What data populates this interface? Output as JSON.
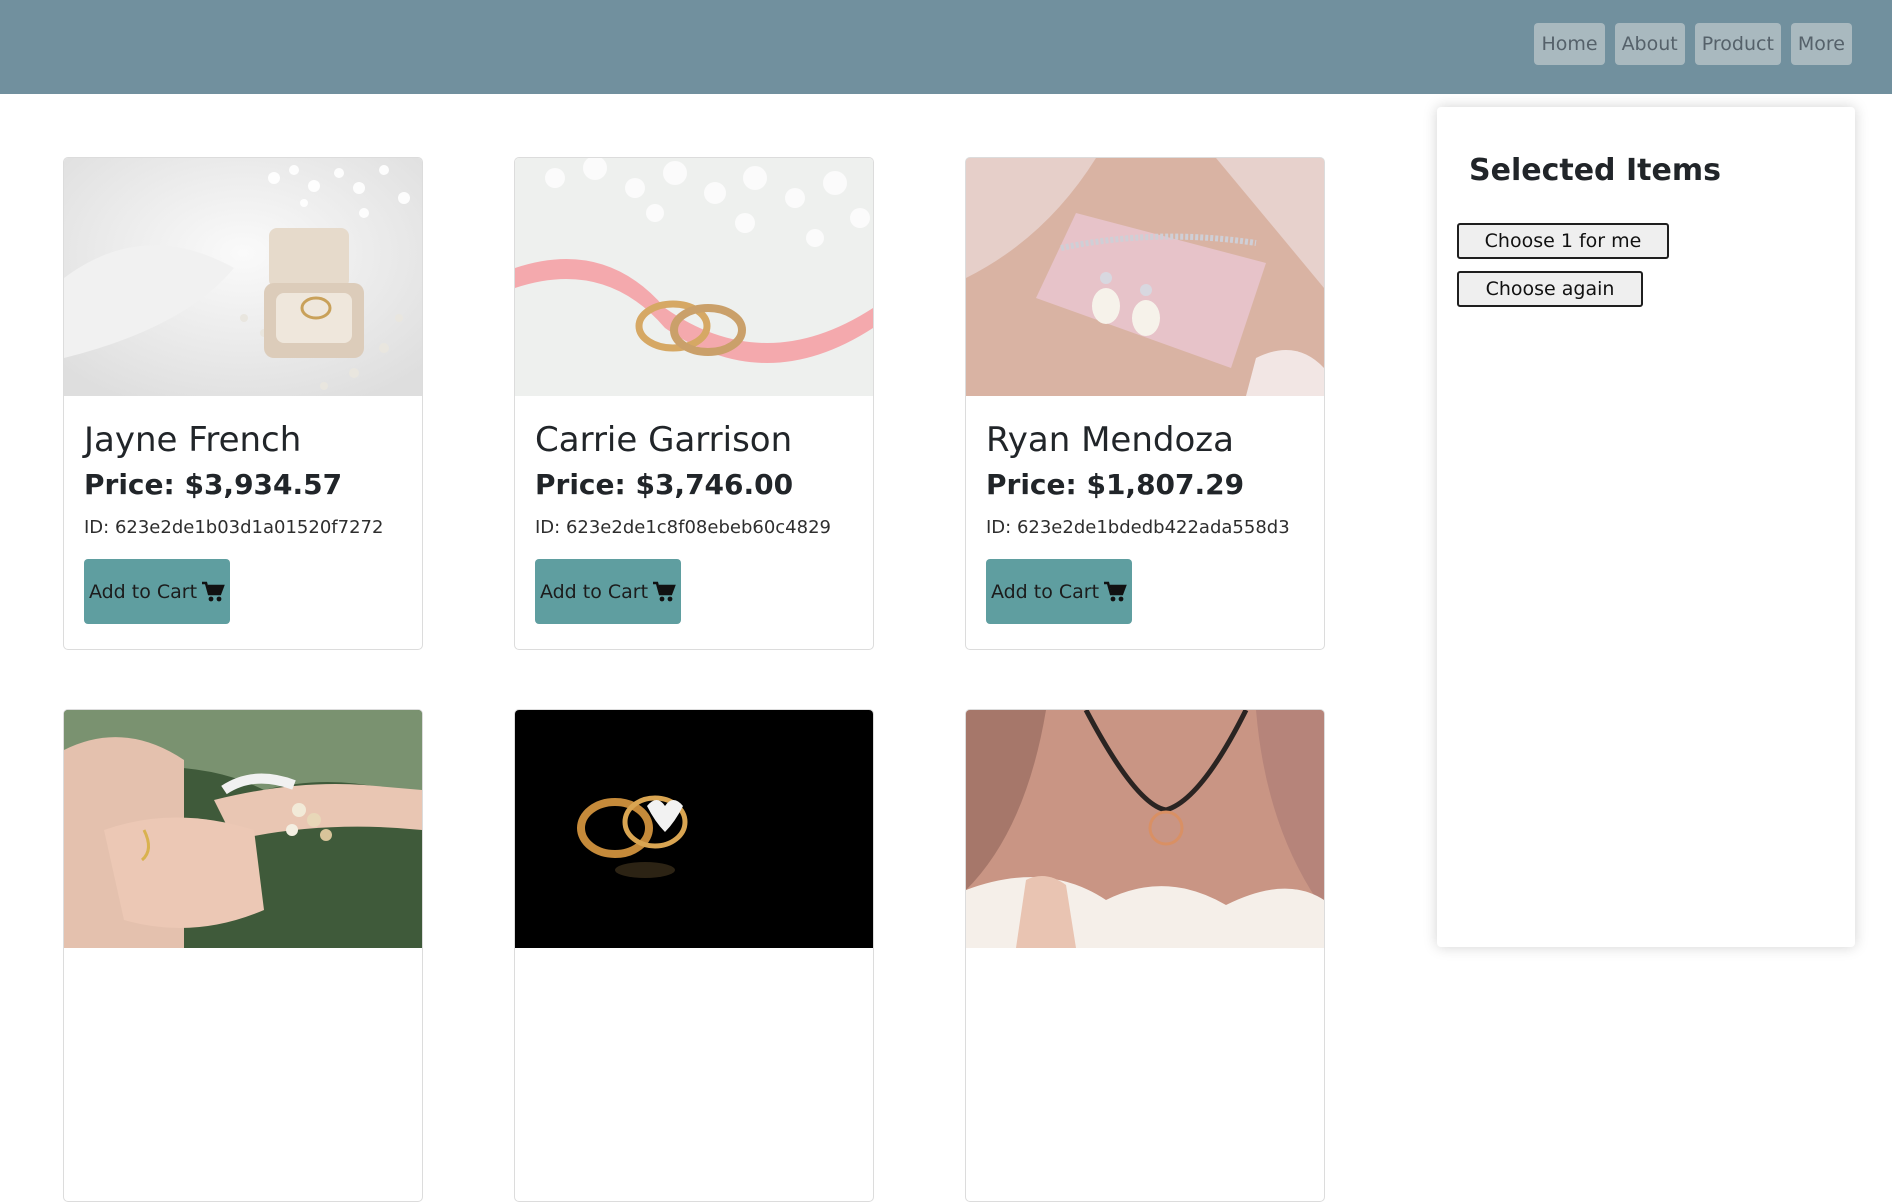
{
  "nav": {
    "items": [
      "Home",
      "About",
      "Product",
      "More"
    ]
  },
  "products": [
    {
      "name": "Jayne French",
      "price": "Price: $3,934.57",
      "id": "ID: 623e2de1b03d1a01520f7272",
      "button": "Add to Cart",
      "image": "ring-box-photo"
    },
    {
      "name": "Carrie Garrison",
      "price": "Price: $3,746.00",
      "id": "ID: 623e2de1c8f08ebeb60c4829",
      "button": "Add to Cart",
      "image": "wedding-bands-photo"
    },
    {
      "name": "Ryan Mendoza",
      "price": "Price: $1,807.29",
      "id": "ID: 623e2de1bdedb422ada558d3",
      "button": "Add to Cart",
      "image": "pearl-earrings-photo"
    },
    {
      "image": "bracelet-photo"
    },
    {
      "image": "heart-ring-photo"
    },
    {
      "image": "pendant-necklace-photo"
    }
  ],
  "sidebar": {
    "title": "Selected Items",
    "choose_one": "Choose 1 for me",
    "choose_again": "Choose again"
  },
  "colors": {
    "navbar": "#71909e",
    "nav_button": "#a9b9bf",
    "add_to_cart": "#5f9ea0"
  }
}
